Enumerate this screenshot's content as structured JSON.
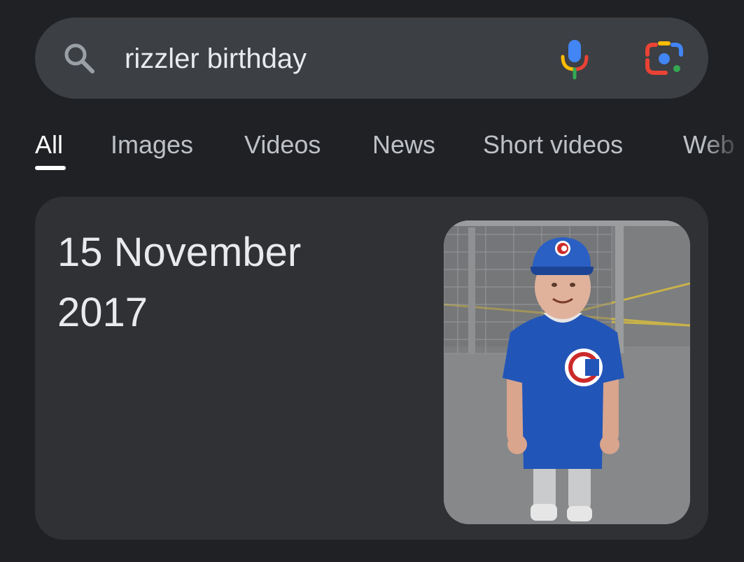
{
  "search": {
    "query": "rizzler birthday"
  },
  "icons": {
    "search": "search-icon",
    "mic": "microphone-icon",
    "lens": "google-lens-icon"
  },
  "tabs": [
    "All",
    "Images",
    "Videos",
    "News",
    "Short videos",
    "Web"
  ],
  "active_tab": "All",
  "result": {
    "answer_line1": "15 November",
    "answer_line2": "2017"
  },
  "colors": {
    "background": "#202124",
    "searchbar": "#3c3f43",
    "card": "#303134"
  }
}
